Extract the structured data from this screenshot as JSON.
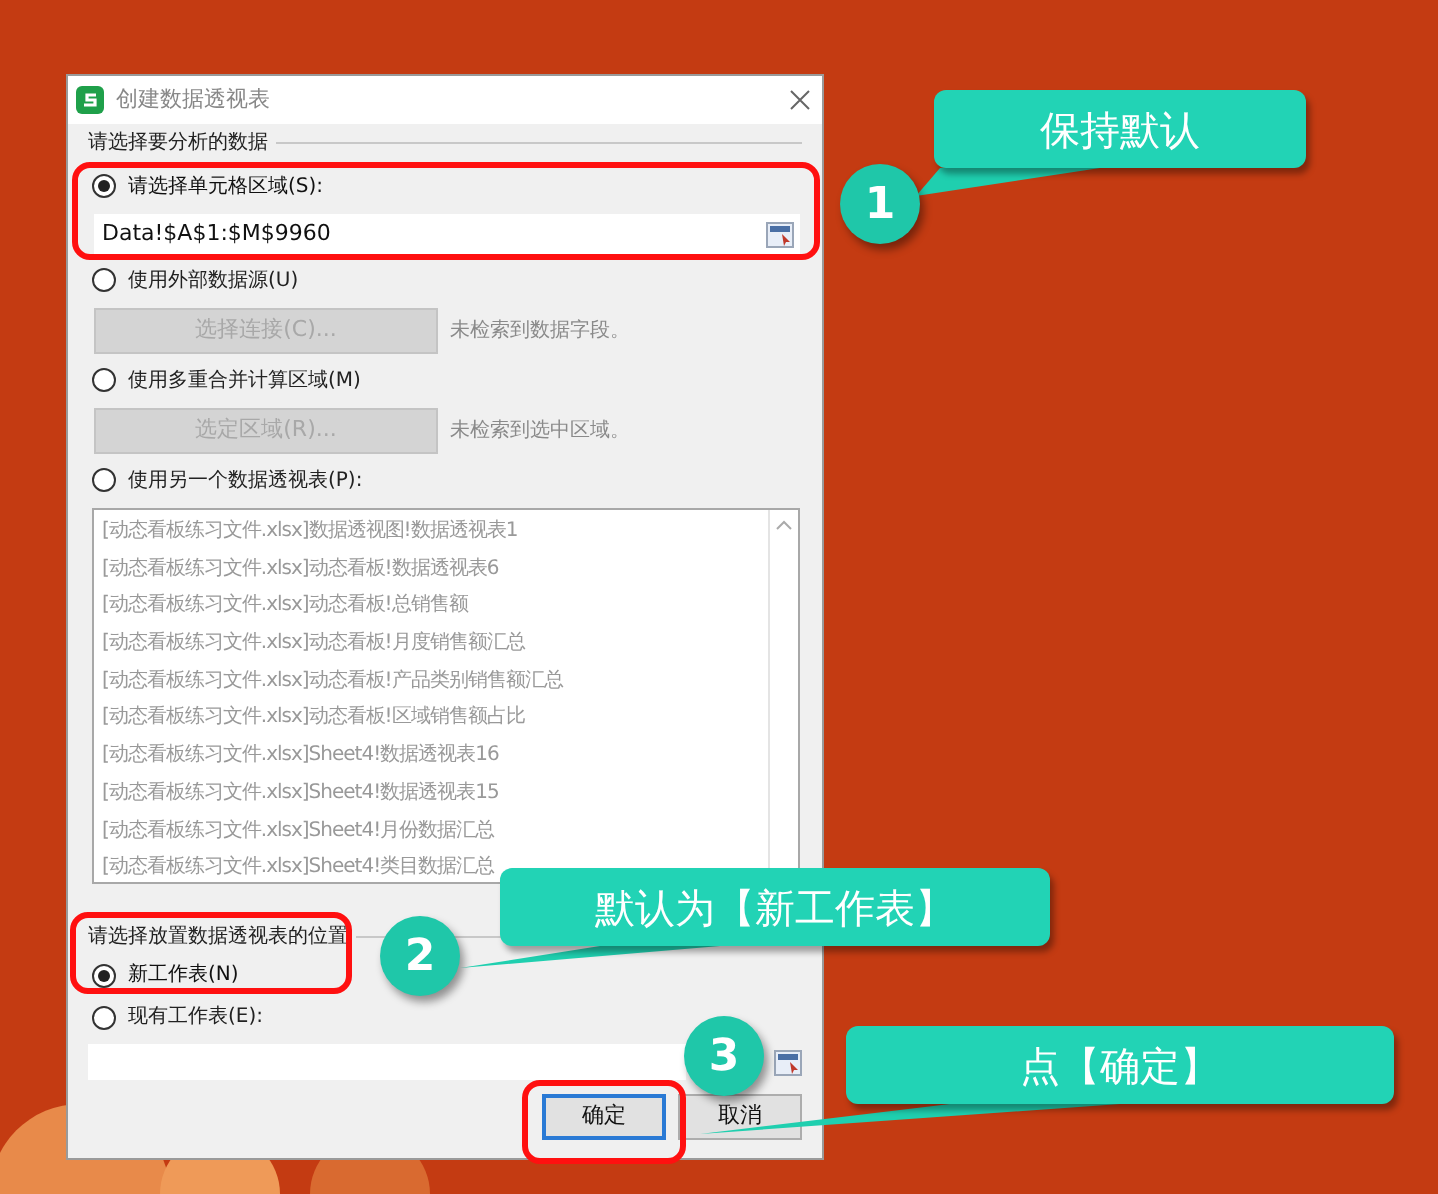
{
  "window": {
    "title": "创建数据透视表"
  },
  "source_section": {
    "legend": "请选择要分析的数据",
    "options": [
      {
        "kind": "range",
        "label": "请选择单元格区域(S):",
        "selected": true,
        "value": "Data!$A$1:$M$9960"
      },
      {
        "kind": "button",
        "label": "使用外部数据源(U)",
        "selected": false,
        "button": "选择连接(C)...",
        "note": "未检索到数据字段。"
      },
      {
        "kind": "button",
        "label": "使用多重合并计算区域(M)",
        "selected": false,
        "button": "选定区域(R)...",
        "note": "未检索到选中区域。"
      },
      {
        "kind": "list",
        "label": "使用另一个数据透视表(P):",
        "selected": false,
        "items": [
          "[动态看板练习文件.xlsx]数据透视图!数据透视表1",
          "[动态看板练习文件.xlsx]动态看板!数据透视表6",
          "[动态看板练习文件.xlsx]动态看板!总销售额",
          "[动态看板练习文件.xlsx]动态看板!月度销售额汇总",
          "[动态看板练习文件.xlsx]动态看板!产品类别销售额汇总",
          "[动态看板练习文件.xlsx]动态看板!区域销售额占比",
          "[动态看板练习文件.xlsx]Sheet4!数据透视表16",
          "[动态看板练习文件.xlsx]Sheet4!数据透视表15",
          "[动态看板练习文件.xlsx]Sheet4!月份数据汇总",
          "[动态看板练习文件.xlsx]Sheet4!类目数据汇总"
        ]
      }
    ]
  },
  "target_section": {
    "legend": "请选择放置数据透视表的位置",
    "options": [
      {
        "kind": "plain",
        "label": "新工作表(N)",
        "selected": true
      },
      {
        "kind": "field",
        "label": "现有工作表(E):",
        "selected": false
      }
    ]
  },
  "buttons": [
    {
      "label": "确定",
      "focused": true
    },
    {
      "label": "取消",
      "focused": false
    }
  ],
  "annotations": [
    {
      "number": "1",
      "text": "保持默认"
    },
    {
      "number": "2",
      "text": "默认为【新工作表】"
    },
    {
      "number": "3",
      "text": "点【确定】"
    }
  ]
}
